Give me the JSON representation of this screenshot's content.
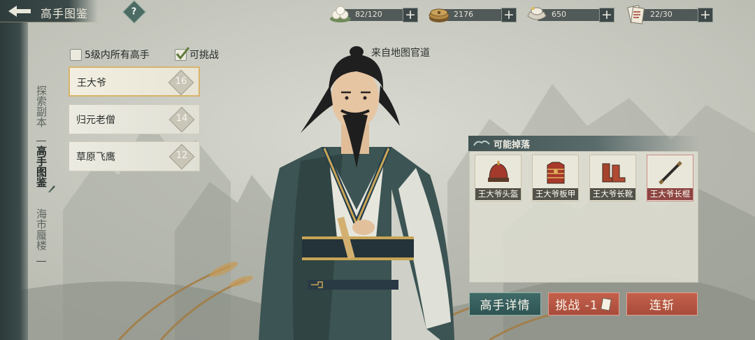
{
  "header": {
    "title": "高手图鉴",
    "help_label": "?"
  },
  "resources": [
    {
      "icon": "steamed-bun-icon",
      "value": "82/120",
      "add": "+"
    },
    {
      "icon": "copper-coins-icon",
      "value": "2176",
      "add": "+"
    },
    {
      "icon": "silver-ingot-icon",
      "value": "650",
      "add": "+"
    },
    {
      "icon": "challenge-ticket-icon",
      "value": "22/30",
      "add": "+"
    }
  ],
  "sidenav": {
    "items": [
      {
        "label": "探索副本",
        "active": false
      },
      {
        "label": "高手图鉴",
        "active": true
      },
      {
        "label": "海市蜃楼",
        "active": false
      }
    ]
  },
  "filters": {
    "within_level": {
      "label": "5级内所有高手",
      "checked": false
    },
    "challengeable": {
      "label": "可挑战",
      "checked": true
    }
  },
  "masters": [
    {
      "name": "王大爷",
      "level": "16",
      "selected": true
    },
    {
      "name": "归元老僧",
      "level": "14",
      "selected": false
    },
    {
      "name": "草原飞鹰",
      "level": "12",
      "selected": false
    }
  ],
  "source_text": "来自地图官道",
  "drops": {
    "title": "可能掉落",
    "items": [
      {
        "name": "王大爷头盔",
        "icon": "helmet-icon"
      },
      {
        "name": "王大爷板甲",
        "icon": "armor-icon"
      },
      {
        "name": "王大爷长靴",
        "icon": "boots-icon"
      },
      {
        "name": "王大爷长棍",
        "icon": "staff-icon"
      }
    ]
  },
  "actions": {
    "detail": "高手详情",
    "challenge": "挑战 -1",
    "sweep": "连斩"
  },
  "colors": {
    "accent_teal": "#3f6a68",
    "accent_red": "#b6553f",
    "selection_gold": "#d8b46a"
  }
}
